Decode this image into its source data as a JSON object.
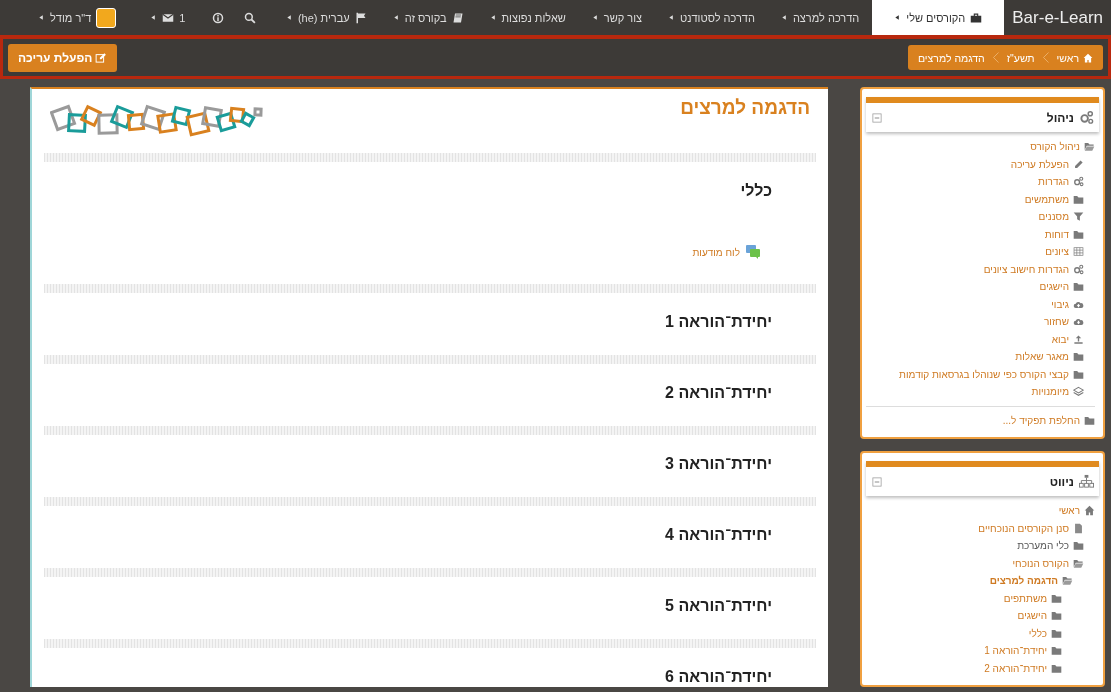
{
  "navbar": {
    "brand": "Bar-e-Learn",
    "menu": [
      {
        "label": "הקורסים שלי",
        "kind": "briefcase",
        "selected": true
      },
      {
        "label": "הדרכה למרצה",
        "selected": false
      },
      {
        "label": "הדרכה לסטודנט",
        "selected": false
      },
      {
        "label": "צור קשר",
        "selected": false
      },
      {
        "label": "שאלות נפוצות",
        "selected": false
      },
      {
        "label": "בקורס זה",
        "kind": "book",
        "selected": false
      },
      {
        "label": "עברית (he)",
        "kind": "flag",
        "selected": false
      }
    ],
    "messages_count": "1",
    "user_name": "ד\"ר מודל"
  },
  "breadcrumb": [
    {
      "label": "ראשי",
      "kind": "home"
    },
    {
      "label": "תשע\"ז"
    },
    {
      "label": "הדגמה למרצים"
    }
  ],
  "edit_button": "הפעלת עריכה",
  "blocks": [
    {
      "title": "ניהול",
      "kind": "gears",
      "tree": [
        {
          "label": "ניהול הקורס",
          "kind": "folder-open",
          "link": true,
          "selected": false,
          "children": [
            {
              "label": "הפעלת עריכה",
              "kind": "pencil",
              "link": true,
              "selected": false
            },
            {
              "label": "הגדרות",
              "kind": "gears",
              "link": true,
              "selected": false
            },
            {
              "label": "משתמשים",
              "kind": "folder",
              "link": true,
              "selected": false
            },
            {
              "label": "מסננים",
              "kind": "filter",
              "link": true,
              "selected": false
            },
            {
              "label": "דוחות",
              "kind": "folder",
              "link": true,
              "selected": false
            },
            {
              "label": "ציונים",
              "kind": "grid",
              "link": true,
              "selected": false
            },
            {
              "label": "הגדרות חישוב ציונים",
              "kind": "gears",
              "link": true,
              "selected": false
            },
            {
              "label": "הישגים",
              "kind": "folder",
              "link": true,
              "selected": false
            },
            {
              "label": "גיבוי",
              "kind": "cloud-up",
              "link": true,
              "selected": false
            },
            {
              "label": "שחזור",
              "kind": "cloud-down",
              "link": true,
              "selected": false
            },
            {
              "label": "יבוא",
              "kind": "upload",
              "link": true,
              "selected": false
            },
            {
              "label": "מאגר שאלות",
              "kind": "folder",
              "link": true,
              "selected": false
            },
            {
              "label": "קבצי הקורס כפי שנוהלו בגרסאות קודמות",
              "kind": "folder",
              "link": true,
              "selected": false
            },
            {
              "label": "מיומנויות",
              "kind": "layers",
              "link": true,
              "selected": false
            }
          ]
        }
      ],
      "footer": [
        {
          "label": "החלפת תפקיד ל...",
          "kind": "folder",
          "link": true,
          "selected": false
        }
      ]
    },
    {
      "title": "ניווט",
      "kind": "sitemap",
      "tree": [
        {
          "label": "ראשי",
          "kind": "home",
          "link": true,
          "selected": false,
          "children": [
            {
              "label": "סנן הקורסים הנוכחיים",
              "kind": "file",
              "link": true,
              "selected": false
            },
            {
              "label": "כלי המערכת",
              "kind": "folder",
              "link": false,
              "selected": false
            },
            {
              "label": "הקורס הנוכחי",
              "kind": "folder-open",
              "link": true,
              "selected": false,
              "children": [
                {
                  "label": "הדגמה למרצים",
                  "kind": "folder-open",
                  "link": true,
                  "selected": true,
                  "children": [
                    {
                      "label": "משתתפים",
                      "kind": "folder",
                      "link": true,
                      "selected": false
                    },
                    {
                      "label": "הישגים",
                      "kind": "folder",
                      "link": true,
                      "selected": false
                    },
                    {
                      "label": "כללי",
                      "kind": "folder",
                      "link": true,
                      "selected": false
                    },
                    {
                      "label": "יחידת־הוראה 1",
                      "kind": "folder",
                      "link": true,
                      "selected": false
                    },
                    {
                      "label": "יחידת־הוראה 2",
                      "kind": "folder",
                      "link": true,
                      "selected": false
                    }
                  ]
                }
              ]
            }
          ]
        }
      ]
    }
  ],
  "course": {
    "title": "הדגמה למרצים",
    "sections": [
      {
        "title": "כללי",
        "activities": [
          {
            "label": "לוח מודעות",
            "kind": "forum"
          }
        ]
      },
      {
        "title": "יחידת־הוראה 1"
      },
      {
        "title": "יחידת־הוראה 2"
      },
      {
        "title": "יחידת־הוראה 3"
      },
      {
        "title": "יחידת־הוראה 4"
      },
      {
        "title": "יחידת־הוראה 5"
      },
      {
        "title": "יחידת־הוראה 6"
      }
    ]
  }
}
